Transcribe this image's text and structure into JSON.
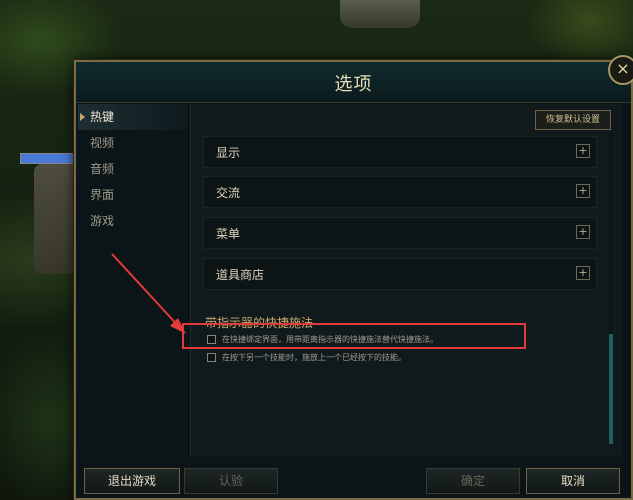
{
  "dialog": {
    "title": "选项",
    "close": "×"
  },
  "sidebar": {
    "items": [
      {
        "label": "热键",
        "active": true
      },
      {
        "label": "视频"
      },
      {
        "label": "音频"
      },
      {
        "label": "界面"
      },
      {
        "label": "游戏"
      }
    ]
  },
  "content": {
    "reset_label": "恢复默认设置",
    "sections": [
      {
        "label": "显示"
      },
      {
        "label": "交流"
      },
      {
        "label": "菜单"
      },
      {
        "label": "道具商店"
      }
    ],
    "expand_symbol": "+",
    "subheading": "带指示器的快捷施法",
    "options": [
      {
        "label": "在快捷绑定界面，用带距离指示器的快捷施法替代快捷施法。",
        "checked": false
      },
      {
        "label": "在按下另一个技能时，施放上一个已经按下的技能。",
        "checked": false
      }
    ]
  },
  "footer": {
    "exit_label": "退出游戏",
    "verify_label": "认验",
    "ok_label": "确定",
    "cancel_label": "取消"
  },
  "colors": {
    "gold": "#c8aa6e",
    "highlight_box": "#e23a3a",
    "accent_teal": "#1f5f60"
  }
}
